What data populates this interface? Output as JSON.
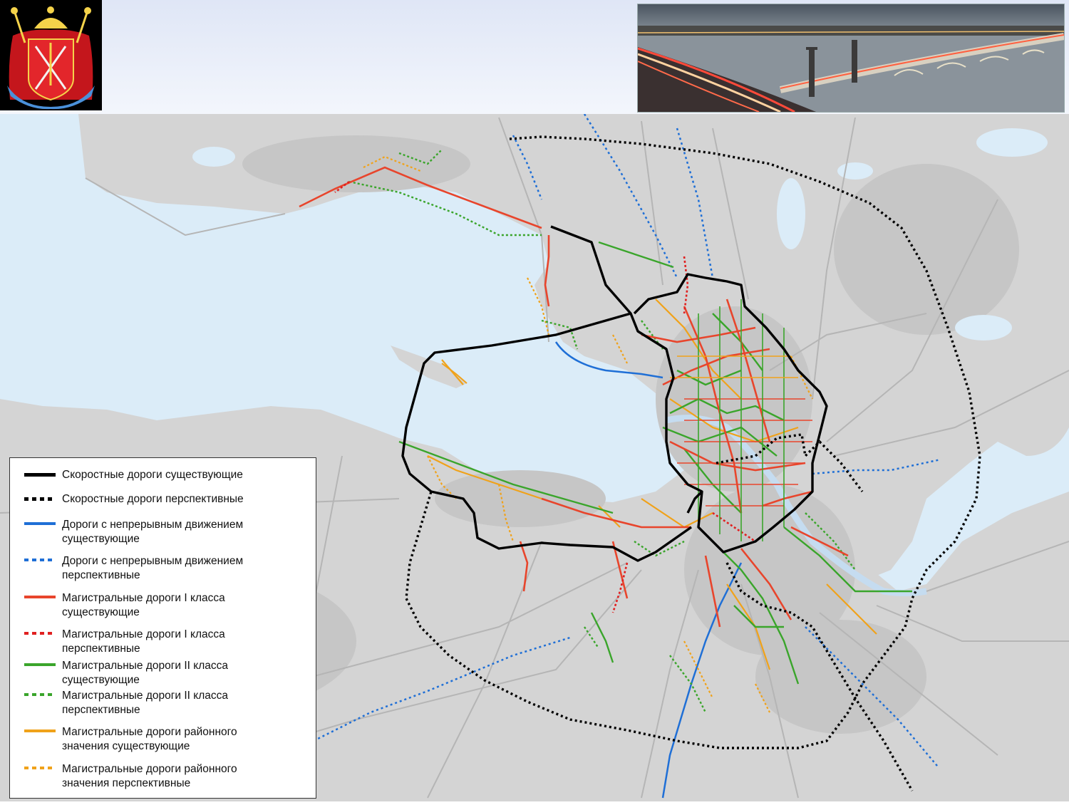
{
  "legend": {
    "items": [
      {
        "label": "Скоростные дороги существующие",
        "color": "#000000",
        "style": "solid"
      },
      {
        "label": "Скоростные дороги перспективные",
        "color": "#000000",
        "style": "dotted"
      },
      {
        "label": "Дороги с непрерывным движением\nсуществующие",
        "color": "#1f6fd6",
        "style": "solid"
      },
      {
        "label": "Дороги с непрерывным движением\nперспективные",
        "color": "#1f6fd6",
        "style": "dotted"
      },
      {
        "label": "Магистральные дороги I класса\nсуществующие",
        "color": "#e8452c",
        "style": "solid"
      },
      {
        "label": "Магистральные дороги I класса\nперспективные",
        "color": "#e02020",
        "style": "dotted"
      },
      {
        "label": "Магистральные дороги II класса\nсуществующие",
        "color": "#3aa52b",
        "style": "solid"
      },
      {
        "label": "Магистральные дороги II класса\nперспективные",
        "color": "#3aa52b",
        "style": "dotted"
      },
      {
        "label": "Магистральные дороги районного\nзначения существующие",
        "color": "#f0a21a",
        "style": "solid"
      },
      {
        "label": "Магистральные дороги районного\nзначения перспективные",
        "color": "#f0a21a",
        "style": "dotted"
      }
    ]
  },
  "colors": {
    "water": "#dbecf8",
    "land": "#d4d4d4",
    "land_dark": "#c6c6c6",
    "road_gray": "#b5b5b5"
  }
}
